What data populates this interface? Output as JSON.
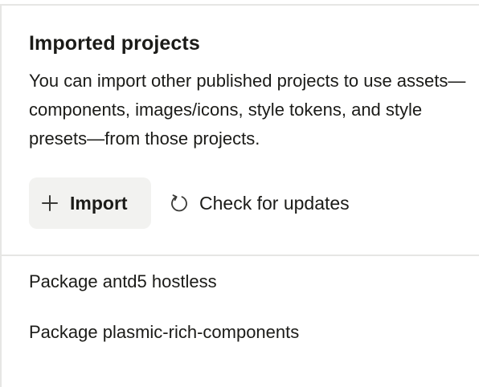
{
  "imported_projects": {
    "title": "Imported projects",
    "description": "You can import other published projects to use assets—components, images/icons, style tokens, and style presets—from those projects.",
    "import_button": {
      "label": "Import",
      "icon": "plus-icon"
    },
    "check_updates": {
      "label": "Check for updates",
      "icon": "refresh-icon"
    },
    "packages": [
      {
        "label": "Package antd5 hostless"
      },
      {
        "label": "Package plasmic-rich-components"
      }
    ]
  }
}
